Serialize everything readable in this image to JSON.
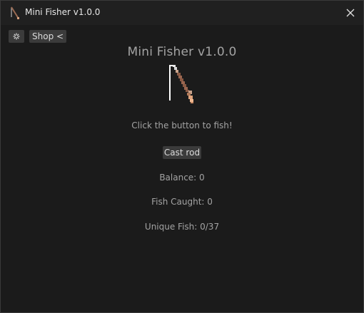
{
  "window": {
    "title": "Mini Fisher v1.0.0",
    "icons": {
      "app": "fishing-rod-icon",
      "close": "close-icon"
    }
  },
  "toolbar": {
    "settings_icon": "settings-icon",
    "shop_label": "Shop <"
  },
  "main": {
    "heading": "Mini Fisher v1.0.0",
    "rod_icon": "fishing-rod-icon",
    "instruction": "Click the button to fish!",
    "cast_label": "Cast rod",
    "stats": {
      "balance": "Balance: 0",
      "fish_caught": "Fish Caught: 0",
      "unique_fish": "Unique Fish: 0/37"
    }
  },
  "colors": {
    "background": "#1b1b1b",
    "titlebar": "#202020",
    "button": "#3b3b3b",
    "text": "#a3a3a3",
    "rod_wood": "#8a5a44"
  }
}
